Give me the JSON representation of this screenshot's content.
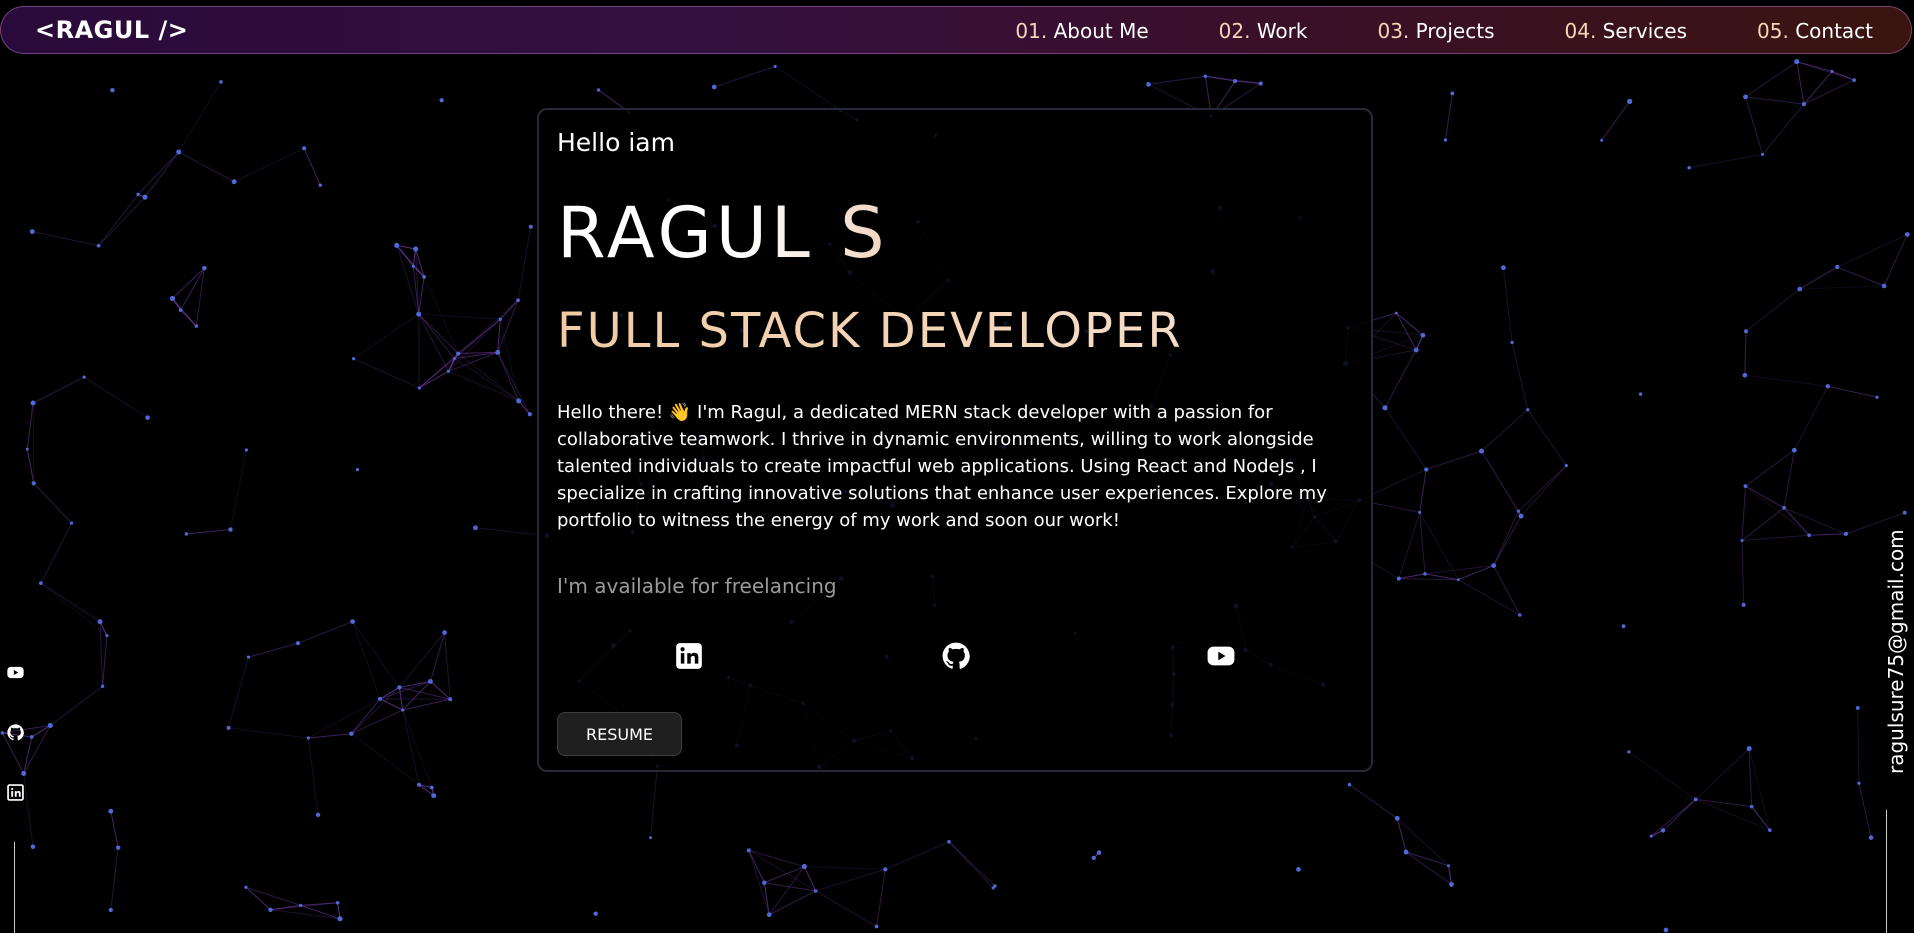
{
  "header": {
    "logo": "<RAGUL />",
    "nav": [
      {
        "num": "01.",
        "label": "About Me"
      },
      {
        "num": "02.",
        "label": "Work"
      },
      {
        "num": "03.",
        "label": "Projects"
      },
      {
        "num": "04.",
        "label": "Services"
      },
      {
        "num": "05.",
        "label": "Contact"
      }
    ]
  },
  "hero": {
    "greeting": "Hello iam",
    "name": "RAGUL S",
    "role": "FULL STACK DEVELOPER",
    "bio": "Hello there! 👋 I'm Ragul, a dedicated MERN stack developer with a passion for collaborative teamwork. I thrive in dynamic environments, willing to work alongside talented individuals to create impactful web applications. Using React and NodeJs , I specialize in crafting innovative solutions that enhance user experiences. Explore my portfolio to witness the energy of my work and soon our work!",
    "availability": "I'm available for freelancing",
    "social_icons": [
      "linkedin-icon",
      "github-icon",
      "youtube-icon"
    ],
    "resume_label": "RESUME"
  },
  "sidebar_left": {
    "icons": [
      "youtube-icon",
      "github-icon",
      "linkedin-icon"
    ]
  },
  "sidebar_right": {
    "email": "ragulsure75@gmail.com"
  },
  "colors": {
    "background": "#000000",
    "accent_peach": "#f5d6b8",
    "particle_dot": "#4f6ad8",
    "particle_line": "#7a3fb0",
    "card_border": "#262a38",
    "nav_gradient_start": "#2a0a3a",
    "nav_gradient_end": "#3a140f"
  }
}
